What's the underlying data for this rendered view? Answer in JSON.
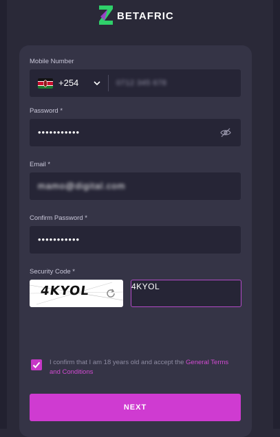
{
  "brand": {
    "name": "BETAFRIC"
  },
  "form": {
    "mobile": {
      "label": "Mobile Number",
      "country_code": "+254",
      "value": "0712 345 678"
    },
    "password": {
      "label": "Password *",
      "value": "•••••••••••"
    },
    "email": {
      "label": "Email *",
      "value": "mamo@digital.com"
    },
    "confirm_password": {
      "label": "Confirm Password *",
      "value": "•••••••••••"
    },
    "security_code": {
      "label": "Security Code *",
      "captcha_text": "4KYOL",
      "value": "4KYOL"
    },
    "terms": {
      "text": "I confirm that I am 18 years old and accept the ",
      "link": "General Terms and Conditions"
    },
    "submit_label": "NEXT"
  },
  "colors": {
    "accent": "#cf3bd1",
    "card": "#353446",
    "field": "#262536",
    "background": "#2a2938"
  }
}
